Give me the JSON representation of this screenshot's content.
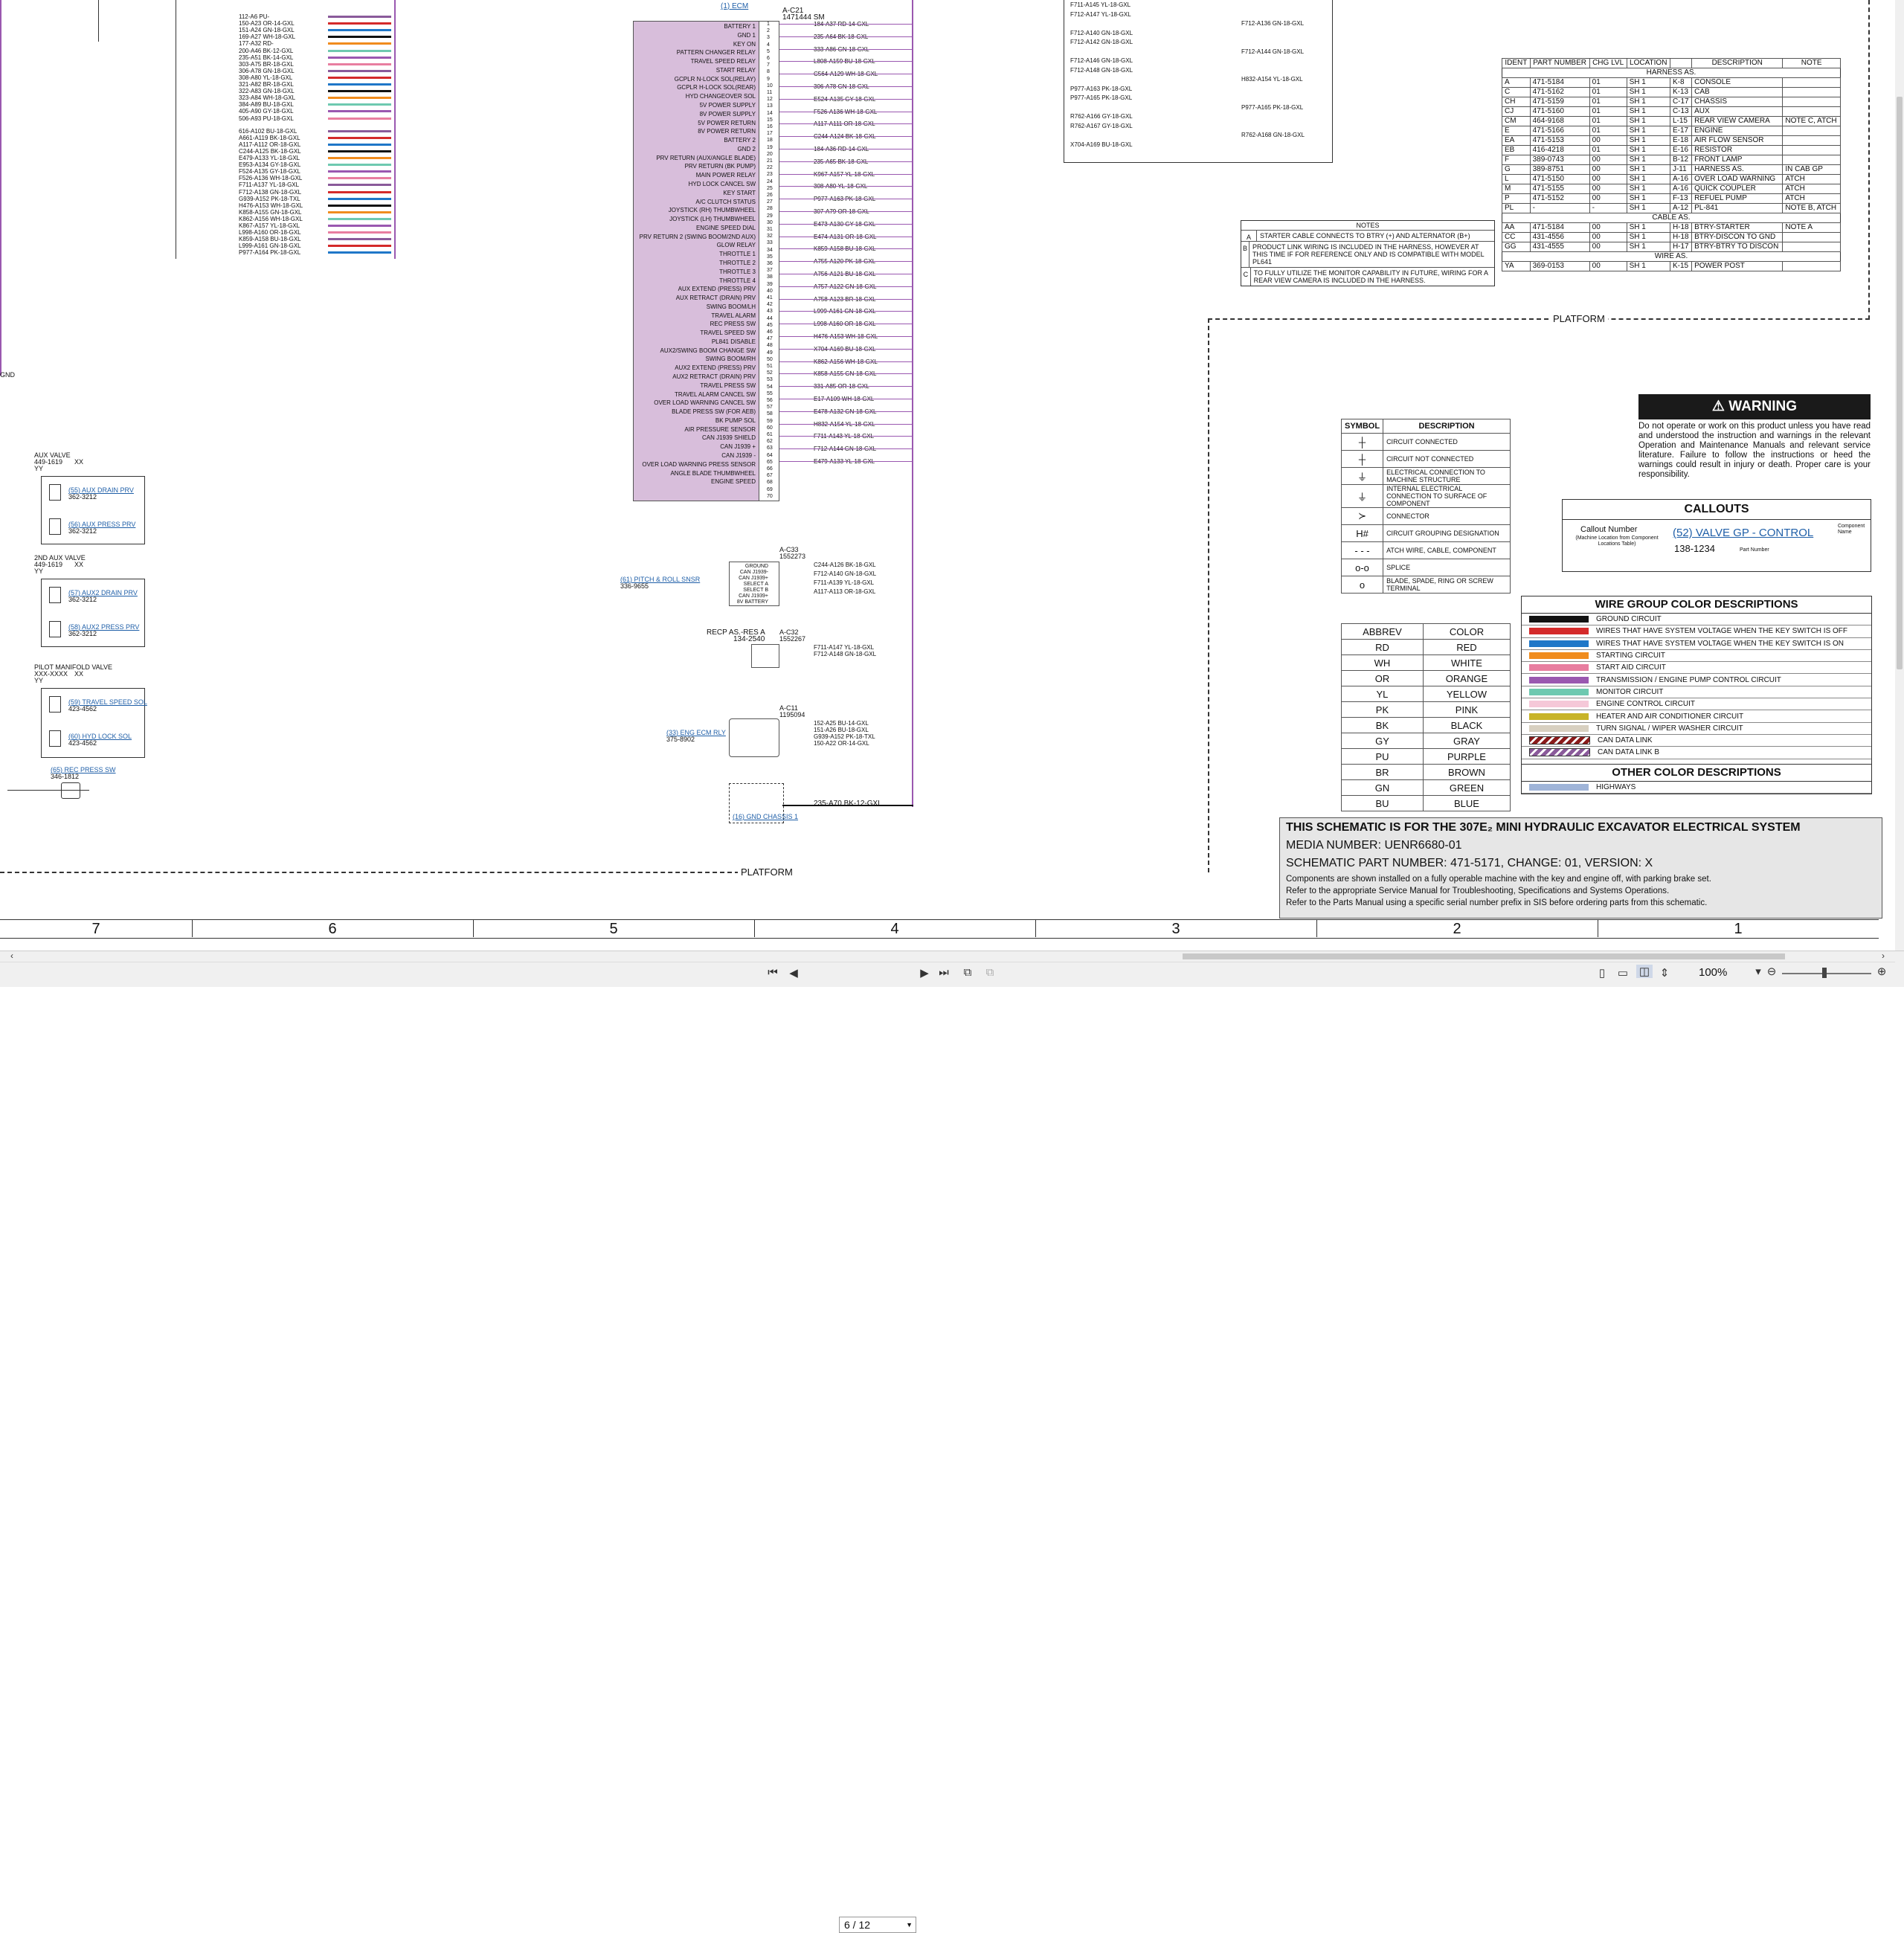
{
  "viewer": {
    "page_value": "6 / 12",
    "zoom": "100%"
  },
  "colors": {
    "connector_fill": "#d8bedb",
    "title_block_bg": "#e6e6e6",
    "warning_header": "#1a1a1a"
  },
  "connector": {
    "ref": "(1) ECM",
    "id": "A-C21",
    "part": "1471444 SM",
    "pin_labels": [
      "BATTERY 1",
      "GND 1",
      "KEY ON",
      "PATTERN CHANGER RELAY",
      "TRAVEL SPEED RELAY",
      "START RELAY",
      "GCPLR N-LOCK SOL(RELAY)",
      "GCPLR H-LOCK SOL(REAR)",
      "HYD CHANGEOVER SOL",
      "5V POWER SUPPLY",
      "8V POWER SUPPLY",
      "5V POWER RETURN",
      "8V POWER RETURN",
      "BATTERY 2",
      "GND 2",
      "PRV RETURN (AUX/ANGLE BLADE)",
      "PRV RETURN (BK PUMP)",
      "MAIN POWER RELAY",
      "HYD LOCK CANCEL SW",
      "KEY START",
      "A/C CLUTCH STATUS",
      "JOYSTICK (RH) THUMBWHEEL",
      "JOYSTICK (LH) THUMBWHEEL",
      "ENGINE SPEED DIAL",
      "PRV RETURN 2 (SWING BOOM/2ND AUX)",
      "GLOW RELAY",
      "THROTTLE 1",
      "THROTTLE 2",
      "THROTTLE 3",
      "THROTTLE 4",
      "AUX EXTEND (PRESS) PRV",
      "AUX RETRACT (DRAIN) PRV",
      "SWING BOOM/LH",
      "TRAVEL ALARM",
      "REC PRESS SW",
      "TRAVEL SPEED SW",
      "PL841 DISABLE",
      "AUX2/SWING BOOM CHANGE SW",
      "SWING BOOM/RH",
      "AUX2 EXTEND (PRESS) PRV",
      "AUX2 RETRACT (DRAIN) PRV",
      "TRAVEL PRESS SW",
      "TRAVEL ALARM CANCEL SW",
      "OVER LOAD WARNING CANCEL SW",
      "BLADE PRESS SW (FOR AEB)",
      "BK PUMP SOL",
      "AIR PRESSURE SENSOR",
      "CAN J1939 SHIELD",
      "CAN J1939 +",
      "CAN J1939 -",
      "OVER LOAD WARNING PRESS SENSOR",
      "ANGLE BLADE THUMBWHEEL",
      "ENGINE SPEED"
    ],
    "wires_right": [
      "184-A37 RD-14-GXL",
      "235-A64 BK-18-GXL",
      "333-A86 GN-18-GXL",
      "L808-A159 BU-18-GXL",
      "C564-A129 WH-18-GXL",
      "306-A78 GN-18-GXL",
      "E524-A135 GY-18-GXL",
      "F526-A136 WH-18-GXL",
      "A117-A111 OR-18-GXL",
      "C244-A124 BK-18-GXL",
      "184-A36 RD-14-GXL",
      "235-A65 BK-18-GXL",
      "K967-A157 YL-18-GXL",
      "308-A80 YL-18-GXL",
      "P977-A163 PK-18-GXL",
      "307-A79 OR-18-GXL",
      "E473-A130 GY-18-GXL",
      "E474-A131 OR-18-GXL",
      "K859-A158 BU-18-GXL",
      "A755-A120 PK-18-GXL",
      "A756-A121 BU-18-GXL",
      "A757-A122 GN-18-GXL",
      "A758-A123 BR-18-GXL",
      "L999-A161 GN-18-GXL",
      "L998-A160 OR-18-GXL",
      "H476-A153 WH-18-GXL",
      "X704-A169 BU-18-GXL",
      "K862-A156 WH-18-GXL",
      "K858-A155 GN-18-GXL",
      "331-A85 OR-18-GXL",
      "E17-A109 WH-18-GXL",
      "E478-A132 GN-18-GXL",
      "H832-A154 YL-18-GXL",
      "F711-A143 YL-18-GXL",
      "F712-A144 GN-18-GXL",
      "E479-A133 YL-18-GXL"
    ]
  },
  "left_bundle": {
    "labels": [
      "112-A6 PU-",
      "150-A23 OR-14-GXL",
      "151-A24 GN-18-GXL",
      "169-A27 WH-18-GXL",
      "177-A32 RD-",
      "200-A46 BK-12-GXL",
      "235-A51 BK-14-GXL",
      "303-A75 BR-18-GXL",
      "306-A78 GN-18-GXL",
      "308-A80 YL-18-GXL",
      "321-A82 BR-18-GXL",
      "322-A83 GN-18-GXL",
      "323-A84 WH-18-GXL",
      "384-A89 BU-18-GXL",
      "405-A90 GY-18-GXL",
      "506-A93 PU-18-GXL",
      "616-A102 BU-18-GXL",
      "A661-A119 BK-18-GXL",
      "A117-A112 OR-18-GXL",
      "C244-A125 BK-18-GXL",
      "E479-A133 YL-18-GXL",
      "E953-A134 GY-18-GXL",
      "F524-A135 GY-18-GXL",
      "F526-A136 WH-18-GXL",
      "F711-A137 YL-18-GXL",
      "F712-A138 GN-18-GXL",
      "G939-A152 PK-18-TXL",
      "H476-A153 WH-18-GXL",
      "K858-A155 GN-18-GXL",
      "K862-A156 WH-18-GXL",
      "K867-A157 YL-18-GXL",
      "L998-A160 OR-18-GXL",
      "K859-A158 BU-18-GXL",
      "L999-A161 GN-18-GXL",
      "P977-A164 PK-18-GXL"
    ]
  },
  "top_right_wires": {
    "labels": [
      "F711-A145 YL-18-GXL",
      "F712-A147 YL-18-GXL",
      "F712-A136 GN-18-GXL",
      "F712-A140 GN-18-GXL",
      "F712-A142 GN-18-GXL",
      "F712-A144 GN-18-GXL",
      "F712-A146 GN-18-GXL",
      "F712-A148 GN-18-GXL",
      "H832-A154 YL-18-GXL",
      "P977-A163 PK-18-GXL",
      "P977-A165 PK-18-GXL",
      "P977-A165 PK-18-GXL",
      "R762-A166 GY-18-GXL",
      "R762-A167 GY-18-GXL",
      "R762-A168 GN-18-GXL",
      "X704-A169 BU-18-GXL"
    ]
  },
  "components": {
    "aux_valve": {
      "title": "AUX VALVE",
      "part": "449-1619",
      "rev": "XX",
      "sub": "YY",
      "drain": "(55) AUX DRAIN PRV",
      "drain_part": "362-3212",
      "press": "(56) AUX PRESS PRV",
      "press_part": "362-3212"
    },
    "aux2_valve": {
      "title": "2ND AUX VALVE",
      "part": "449-1619",
      "rev": "XX",
      "sub": "YY",
      "drain": "(57) AUX2 DRAIN PRV",
      "drain_part": "362-3212",
      "press": "(58) AUX2 PRESS PRV",
      "press_part": "362-3212"
    },
    "pilot_manifold": {
      "title": "PILOT MANIFOLD VALVE",
      "part": "XXX-XXXX",
      "rev": "XX",
      "sub": "YY",
      "travel": "(59) TRAVEL SPEED SOL",
      "travel_part": "423-4562",
      "hyd": "(60) HYD LOCK SOL",
      "hyd_part": "423-4562"
    },
    "rec_press": {
      "title": "(65) REC PRESS SW",
      "part": "346-1812"
    },
    "pitch_roll": {
      "title": "(61) PITCH & ROLL SNSR",
      "part": "336-9655",
      "id": "A-C33",
      "id_part": "1552273",
      "pins": [
        "GROUND",
        "CAN J1939-",
        "CAN J1939+",
        "SELECT A",
        "SELECT B",
        "CAN J1939+",
        "8V BATTERY"
      ],
      "wires": [
        "C244-A126 BK-18-GXL",
        "F712-A140 GN-18-GXL",
        "F711-A139 YL-18-GXL",
        "A117-A113 OR-18-GXL"
      ]
    },
    "recp_res": {
      "title": "RECP AS.-RES A",
      "part": "134-2540",
      "id": "A-C32",
      "id_part": "1552267",
      "wires": [
        "F711-A147 YL-18-GXL",
        "F712-A148 GN-18-GXL"
      ]
    },
    "eng_ecm_rly": {
      "title": "(33) ENG ECM RLY",
      "part": "375-8902",
      "id": "A-C11",
      "id_part": "1195094",
      "wires": [
        "152-A25 BU-14-GXL",
        "151-A26 BU-18-GXL",
        "G939-A152 PK-18-TXL",
        "150-A22 OR-14-GXL"
      ]
    },
    "gnd_chassis": {
      "title": "(16) GND CHASSIS 1",
      "wire": "235-A70 BK-12-GXL"
    },
    "gnd_left": "GND"
  },
  "platform_label": "PLATFORM",
  "harness_table": {
    "headers": [
      "IDENT",
      "PART NUMBER",
      "CHG LVL",
      "LOCATION",
      "",
      "DESCRIPTION",
      "NOTE"
    ],
    "group1": "HARNESS AS.",
    "rows1": [
      [
        "A",
        "471-5184",
        "01",
        "SH 1",
        "K-8",
        "CONSOLE",
        ""
      ],
      [
        "C",
        "471-5162",
        "01",
        "SH 1",
        "K-13",
        "CAB",
        ""
      ],
      [
        "CH",
        "471-5159",
        "01",
        "SH 1",
        "C-17",
        "CHASSIS",
        ""
      ],
      [
        "CJ",
        "471-5160",
        "01",
        "SH 1",
        "C-13",
        "AUX",
        ""
      ],
      [
        "CM",
        "464-9168",
        "01",
        "SH 1",
        "L-15",
        "REAR VIEW CAMERA",
        "NOTE C, ATCH"
      ],
      [
        "E",
        "471-5166",
        "01",
        "SH 1",
        "E-17",
        "ENGINE",
        ""
      ],
      [
        "EA",
        "471-5153",
        "00",
        "SH 1",
        "E-18",
        "AIR FLOW SENSOR",
        ""
      ],
      [
        "EB",
        "416-4218",
        "01",
        "SH 1",
        "E-16",
        "RESISTOR",
        ""
      ],
      [
        "F",
        "389-0743",
        "00",
        "SH 1",
        "B-12",
        "FRONT LAMP",
        ""
      ],
      [
        "G",
        "389-8751",
        "00",
        "SH 1",
        "J-11",
        "HARNESS AS.",
        "IN CAB GP"
      ],
      [
        "L",
        "471-5150",
        "00",
        "SH 1",
        "A-16",
        "OVER LOAD WARNING",
        "ATCH"
      ],
      [
        "M",
        "471-5155",
        "00",
        "SH 1",
        "A-16",
        "QUICK COUPLER",
        "ATCH"
      ],
      [
        "P",
        "471-5152",
        "00",
        "SH 1",
        "F-13",
        "REFUEL PUMP",
        "ATCH"
      ],
      [
        "PL",
        "-",
        "-",
        "SH 1",
        "A-12",
        "PL-841",
        "NOTE B, ATCH"
      ]
    ],
    "group2": "CABLE AS.",
    "rows2": [
      [
        "AA",
        "471-5184",
        "00",
        "SH 1",
        "H-18",
        "BTRY-STARTER",
        "NOTE A"
      ],
      [
        "CC",
        "431-4556",
        "00",
        "SH 1",
        "H-18",
        "BTRY-DISCON TO GND",
        ""
      ],
      [
        "GG",
        "431-4555",
        "00",
        "SH 1",
        "H-17",
        "BTRY-BTRY TO DISCON",
        ""
      ]
    ],
    "group3": "WIRE AS.",
    "rows3": [
      [
        "YA",
        "369-0153",
        "00",
        "SH 1",
        "K-15",
        "POWER POST",
        ""
      ]
    ]
  },
  "notes": {
    "title": "NOTES",
    "items": [
      {
        "letter": "A",
        "text": "STARTER CABLE CONNECTS TO BTRY (+) AND ALTERNATOR (B+)"
      },
      {
        "letter": "B",
        "text": "PRODUCT LINK WIRING IS INCLUDED IN THE HARNESS, HOWEVER AT THIS TIME IF FOR REFERENCE ONLY AND IS COMPATIBLE WITH MODEL PL641"
      },
      {
        "letter": "C",
        "text": "TO FULLY UTILIZE THE MONITOR CAPABILITY IN FUTURE, WIRING FOR A REAR VIEW CAMERA IS INCLUDED IN THE HARNESS."
      }
    ]
  },
  "symbols": {
    "headers": [
      "SYMBOL",
      "DESCRIPTION"
    ],
    "rows": [
      {
        "glyph": "┼",
        "desc": "CIRCUIT CONNECTED"
      },
      {
        "glyph": "┼",
        "desc": "CIRCUIT NOT CONNECTED"
      },
      {
        "glyph": "⏚",
        "desc": "ELECTRICAL CONNECTION TO MACHINE STRUCTURE"
      },
      {
        "glyph": "⏚",
        "desc": "INTERNAL ELECTRICAL CONNECTION TO SURFACE OF COMPONENT"
      },
      {
        "glyph": "≻",
        "desc": "CONNECTOR"
      },
      {
        "glyph": "H#",
        "desc": "CIRCUIT GROUPING DESIGNATION"
      },
      {
        "glyph": "- - -",
        "desc": "ATCH WIRE, CABLE, COMPONENT"
      },
      {
        "glyph": "o-o",
        "desc": "SPLICE"
      },
      {
        "glyph": "o",
        "desc": "BLADE, SPADE, RING OR SCREW TERMINAL"
      }
    ]
  },
  "abbrev": {
    "headers": [
      "ABBREV",
      "COLOR"
    ],
    "rows": [
      [
        "RD",
        "RED"
      ],
      [
        "WH",
        "WHITE"
      ],
      [
        "OR",
        "ORANGE"
      ],
      [
        "YL",
        "YELLOW"
      ],
      [
        "PK",
        "PINK"
      ],
      [
        "BK",
        "BLACK"
      ],
      [
        "GY",
        "GRAY"
      ],
      [
        "PU",
        "PURPLE"
      ],
      [
        "BR",
        "BROWN"
      ],
      [
        "GN",
        "GREEN"
      ],
      [
        "BU",
        "BLUE"
      ]
    ]
  },
  "warning": {
    "title": "WARNING",
    "body": "Do not operate or work on this product unless you have read and understood the instruction and warnings in the relevant Operation and Maintenance Manuals and relevant service literature. Failure to follow the instructions or heed the warnings could result in injury or death. Proper care is your responsibility."
  },
  "callouts": {
    "title": "CALLOUTS",
    "callout_number": "Callout Number",
    "callout_note": "(Machine Location from Component Locations Table)",
    "example": "(52) VALVE GP - CONTROL",
    "part_number": "138-1234",
    "component_name": "Component Name",
    "part_label": "Part Number"
  },
  "wire_groups": {
    "title": "WIRE GROUP COLOR DESCRIPTIONS",
    "rows": [
      {
        "color": "#111111",
        "hatch": false,
        "desc": "GROUND CIRCUIT"
      },
      {
        "color": "#d42a2a",
        "hatch": false,
        "desc": "WIRES THAT HAVE SYSTEM VOLTAGE WHEN THE KEY SWITCH IS OFF"
      },
      {
        "color": "#1f77c8",
        "hatch": false,
        "desc": "WIRES THAT HAVE SYSTEM VOLTAGE WHEN THE KEY SWITCH IS ON"
      },
      {
        "color": "#f08c1e",
        "hatch": false,
        "desc": "STARTING CIRCUIT"
      },
      {
        "color": "#e87ea0",
        "hatch": false,
        "desc": "START AID CIRCUIT"
      },
      {
        "color": "#9a58b0",
        "hatch": false,
        "desc": "TRANSMISSION / ENGINE PUMP CONTROL CIRCUIT"
      },
      {
        "color": "#6ec9b0",
        "hatch": false,
        "desc": "MONITOR CIRCUIT"
      },
      {
        "color": "#f5c8d8",
        "hatch": false,
        "desc": "ENGINE CONTROL CIRCUIT"
      },
      {
        "color": "#c8b428",
        "hatch": false,
        "desc": "HEATER AND AIR CONDITIONER CIRCUIT"
      },
      {
        "color": "#d8d0c0",
        "hatch": false,
        "desc": "TURN SIGNAL / WIPER WASHER CIRCUIT"
      },
      {
        "color": "#8a1a1a",
        "hatch": true,
        "desc": "CAN DATA LINK"
      },
      {
        "color": "#8a5a9a",
        "hatch": true,
        "desc": "CAN DATA LINK B"
      }
    ],
    "other_title": "OTHER COLOR DESCRIPTIONS",
    "other_rows": [
      {
        "color": "#9fb4d8",
        "desc": "HIGHWAYS"
      }
    ]
  },
  "title_block": {
    "line1": "THIS SCHEMATIC IS FOR THE 307E₂ MINI HYDRAULIC EXCAVATOR ELECTRICAL SYSTEM",
    "line2": "MEDIA NUMBER: UENR6680-01",
    "line3": "SCHEMATIC PART NUMBER: 471-5171, CHANGE: 01, VERSION: X",
    "line4": "Components are shown installed on a fully operable machine with the key and engine off, with parking brake set.",
    "line5": "Refer to the appropriate Service Manual for Troubleshooting, Specifications and Systems Operations.",
    "line6": "Refer to the Parts Manual using a specific serial number prefix in SIS before ordering parts from this schematic."
  },
  "zones": [
    "7",
    "6",
    "5",
    "4",
    "3",
    "2",
    "1"
  ]
}
